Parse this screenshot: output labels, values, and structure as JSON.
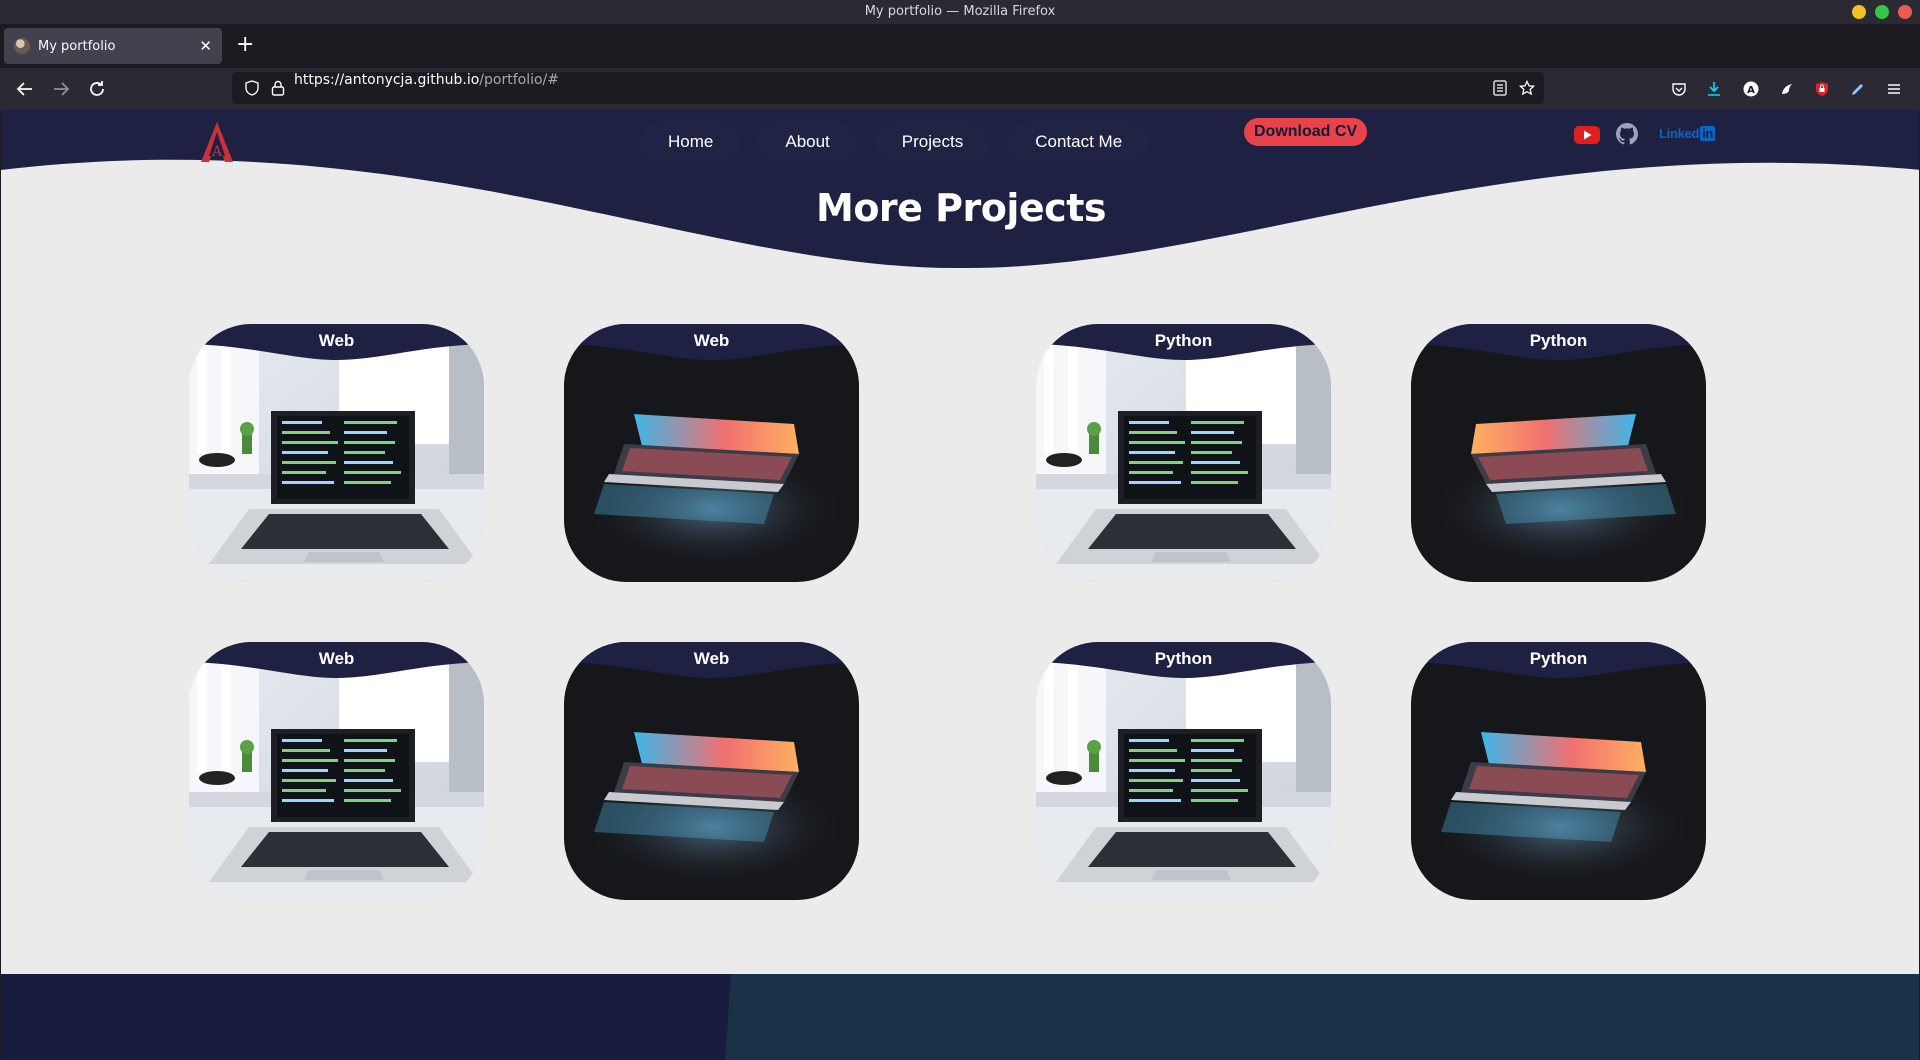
{
  "browser": {
    "window_title": "My portfolio — Mozilla Firefox",
    "tab_title": "My portfolio",
    "url_host": "https://antonycja.github.io",
    "url_path": "/portfolio/#"
  },
  "site": {
    "nav": [
      "Home",
      "About",
      "Projects",
      "Contact Me"
    ],
    "cv_button": "Download CV",
    "linkedin_text": "Linked",
    "linkedin_in": "in",
    "section_title": "More Projects",
    "projects": [
      {
        "tag": "Web",
        "image": "laptop-desk"
      },
      {
        "tag": "Web",
        "image": "laptop-dark"
      },
      {
        "tag": "Python",
        "image": "laptop-desk"
      },
      {
        "tag": "Python",
        "image": "laptop-dark"
      },
      {
        "tag": "Web",
        "image": "laptop-desk"
      },
      {
        "tag": "Web",
        "image": "laptop-dark"
      },
      {
        "tag": "Python",
        "image": "laptop-desk"
      },
      {
        "tag": "Python",
        "image": "laptop-dark"
      }
    ]
  },
  "colors": {
    "header_navy": "#1e2142",
    "accent_red": "#e8434a",
    "page_bg": "#ebebeb"
  }
}
